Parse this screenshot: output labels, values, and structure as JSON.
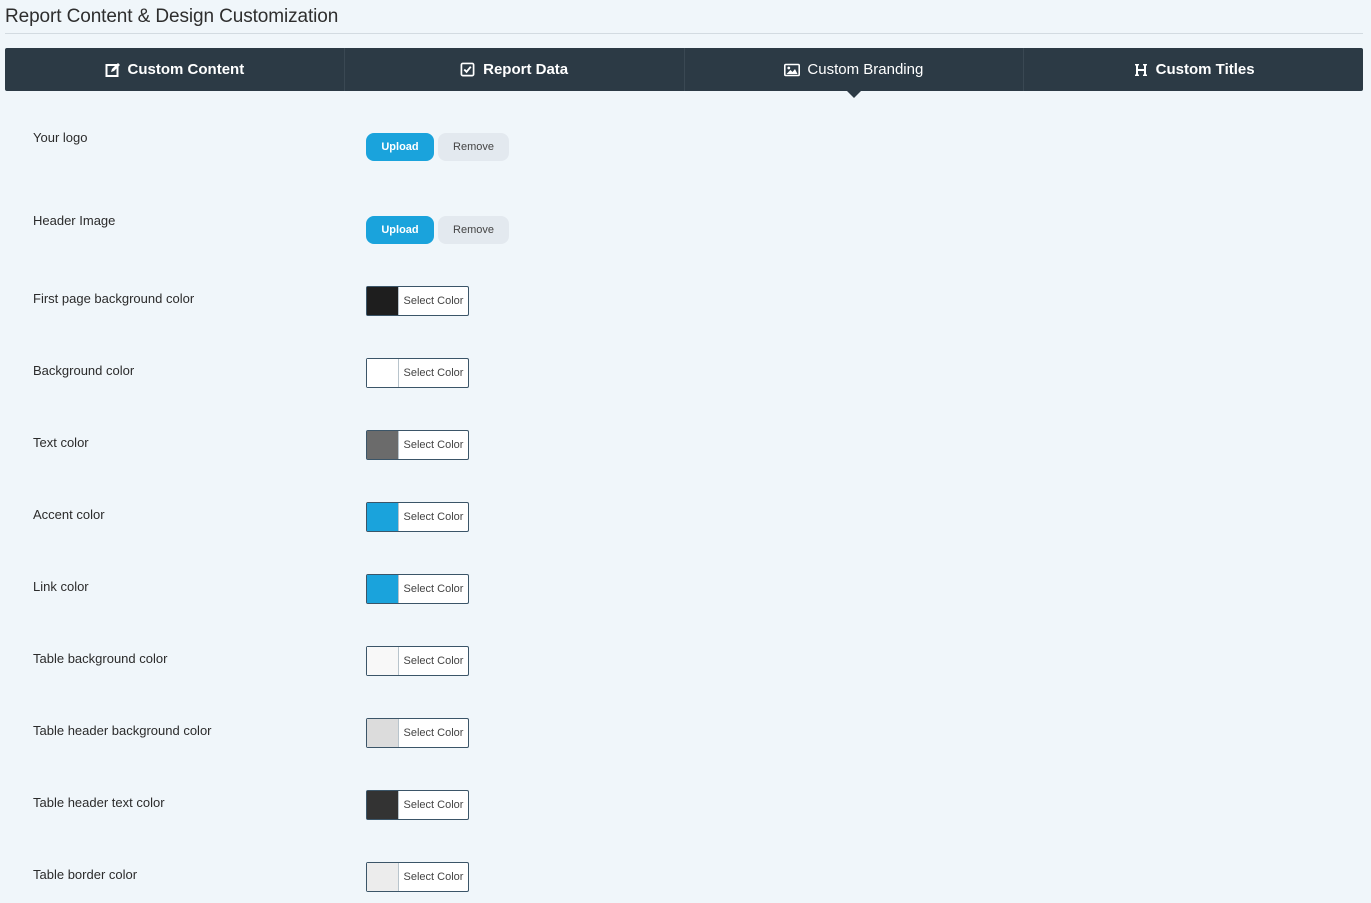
{
  "page": {
    "title": "Report Content & Design Customization"
  },
  "tabs": [
    {
      "label": "Custom Content",
      "icon": "edit-icon",
      "active": false
    },
    {
      "label": "Report Data",
      "icon": "checkbox-icon",
      "active": false
    },
    {
      "label": "Custom Branding",
      "icon": "image-icon",
      "active": true
    },
    {
      "label": "Custom Titles",
      "icon": "heading-icon",
      "active": false
    }
  ],
  "image_fields": [
    {
      "label": "Your logo",
      "upload_label": "Upload",
      "remove_label": "Remove"
    },
    {
      "label": "Header Image",
      "upload_label": "Upload",
      "remove_label": "Remove"
    }
  ],
  "color_fields": [
    {
      "label": "First page background color",
      "color": "#1e1e1e",
      "button_label": "Select Color"
    },
    {
      "label": "Background color",
      "color": "#ffffff",
      "button_label": "Select Color"
    },
    {
      "label": "Text color",
      "color": "#6b6b6b",
      "button_label": "Select Color"
    },
    {
      "label": "Accent color",
      "color": "#1aa3dc",
      "button_label": "Select Color"
    },
    {
      "label": "Link color",
      "color": "#1aa3dc",
      "button_label": "Select Color"
    },
    {
      "label": "Table background color",
      "color": "#f8f8f8",
      "button_label": "Select Color"
    },
    {
      "label": "Table header background color",
      "color": "#dcdcdc",
      "button_label": "Select Color"
    },
    {
      "label": "Table header text color",
      "color": "#333333",
      "button_label": "Select Color"
    },
    {
      "label": "Table border color",
      "color": "#ececec",
      "button_label": "Select Color"
    }
  ]
}
